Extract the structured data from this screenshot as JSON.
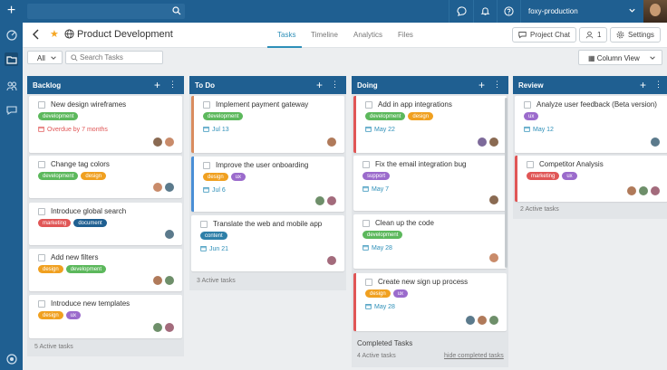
{
  "app": {
    "org_name": "foxy-production",
    "brand_color": "#1f5f91"
  },
  "project": {
    "title": "Product Development"
  },
  "tabs": [
    {
      "label": "Tasks",
      "active": true
    },
    {
      "label": "Timeline",
      "active": false
    },
    {
      "label": "Analytics",
      "active": false
    },
    {
      "label": "Files",
      "active": false
    }
  ],
  "header_buttons": {
    "project_chat": "Project Chat",
    "members_count": "1",
    "settings": "Settings"
  },
  "toolbar": {
    "filter_value": "All",
    "search_placeholder": "Search Tasks",
    "view_label": "Column View"
  },
  "tag_colors": {
    "development": "#5cb85c",
    "design": "#f0a020",
    "marketing": "#e05656",
    "ux": "#9b6bcc",
    "document": "#1f5f91",
    "content": "#2e7fa8",
    "support": "#9b6bcc"
  },
  "columns": [
    {
      "name": "Backlog",
      "footer": "5 Active tasks",
      "cards": [
        {
          "title": "New design wireframes",
          "tags": [
            "development"
          ],
          "due": "Overdue by 7 months",
          "overdue": true,
          "avatars": 2
        },
        {
          "title": "Change tag colors",
          "tags": [
            "development",
            "design"
          ],
          "due": "",
          "avatars": 2
        },
        {
          "title": "Introduce global search",
          "tags": [
            "marketing",
            "document"
          ],
          "due": "",
          "avatars": 1
        },
        {
          "title": "Add new filters",
          "tags": [
            "design",
            "development"
          ],
          "due": "",
          "avatars": 2
        },
        {
          "title": "Introduce new templates",
          "tags": [
            "design",
            "ux"
          ],
          "due": "",
          "avatars": 2
        }
      ]
    },
    {
      "name": "To Do",
      "footer": "3 Active tasks",
      "cards": [
        {
          "title": "Implement payment gateway",
          "tags": [
            "development"
          ],
          "due": "Jul 13",
          "avatars": 1,
          "accent": "orange"
        },
        {
          "title": "Improve the user onboarding",
          "tags": [
            "design",
            "ux"
          ],
          "due": "Jul 6",
          "avatars": 2,
          "accent": "blue"
        },
        {
          "title": "Translate the web and mobile app",
          "tags": [
            "content"
          ],
          "due": "Jun 21",
          "avatars": 1
        }
      ]
    },
    {
      "name": "Doing",
      "footer": "",
      "cards": [
        {
          "title": "Add in app integrations",
          "tags": [
            "development",
            "design"
          ],
          "due": "May 22",
          "avatars": 2,
          "accent": "red"
        },
        {
          "title": "Fix the email integration bug",
          "tags": [
            "support"
          ],
          "due": "May 7",
          "avatars": 1
        },
        {
          "title": "Clean up the code",
          "tags": [
            "development"
          ],
          "due": "May 28",
          "avatars": 1
        },
        {
          "title": "Create new sign up process",
          "tags": [
            "design",
            "ux"
          ],
          "due": "May 28",
          "avatars": 3,
          "accent": "red"
        }
      ],
      "completed_label": "Completed Tasks",
      "completed_count": "4 Active tasks",
      "hide_link": "hide completed tasks"
    },
    {
      "name": "Review",
      "footer": "2 Active tasks",
      "cards": [
        {
          "title": "Analyze user feedback (Beta version)",
          "tags": [
            "ux"
          ],
          "due": "May 12",
          "avatars": 1
        },
        {
          "title": "Competitor Analysis",
          "tags": [
            "marketing",
            "ux"
          ],
          "due": "",
          "avatars": 3,
          "accent": "red"
        }
      ]
    }
  ]
}
